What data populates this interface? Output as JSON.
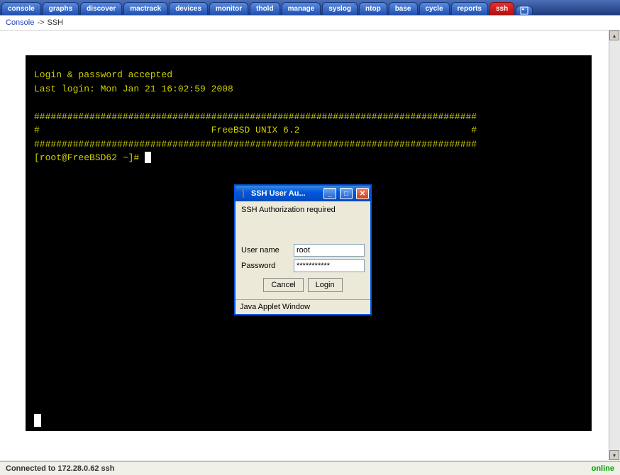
{
  "tabs": [
    {
      "label": "console"
    },
    {
      "label": "graphs"
    },
    {
      "label": "discover"
    },
    {
      "label": "mactrack"
    },
    {
      "label": "devices"
    },
    {
      "label": "monitor"
    },
    {
      "label": "thold"
    },
    {
      "label": "manage"
    },
    {
      "label": "syslog"
    },
    {
      "label": "ntop"
    },
    {
      "label": "base"
    },
    {
      "label": "cycle"
    },
    {
      "label": "reports"
    },
    {
      "label": "ssh",
      "active": true
    }
  ],
  "breadcrumb": {
    "link": "Console",
    "sep": "->",
    "current": "SSH"
  },
  "terminal": {
    "line1": "Login & password accepted",
    "line2": "Last login: Mon Jan 21 16:02:59 2008",
    "hash_border": "################################################################################",
    "banner_line": "#                               FreeBSD UNIX 6.2                               #",
    "prompt": "[root@FreeBSD62 ~]# "
  },
  "dialog": {
    "title": "SSH User Au...",
    "message": "SSH Authorization required",
    "username_label": "User name",
    "username_value": "root",
    "password_label": "Password",
    "password_value": "***********",
    "cancel": "Cancel",
    "login": "Login",
    "footer": "Java Applet Window"
  },
  "status": {
    "left": "Connected to 172.28.0.62 ssh",
    "right": "online"
  }
}
